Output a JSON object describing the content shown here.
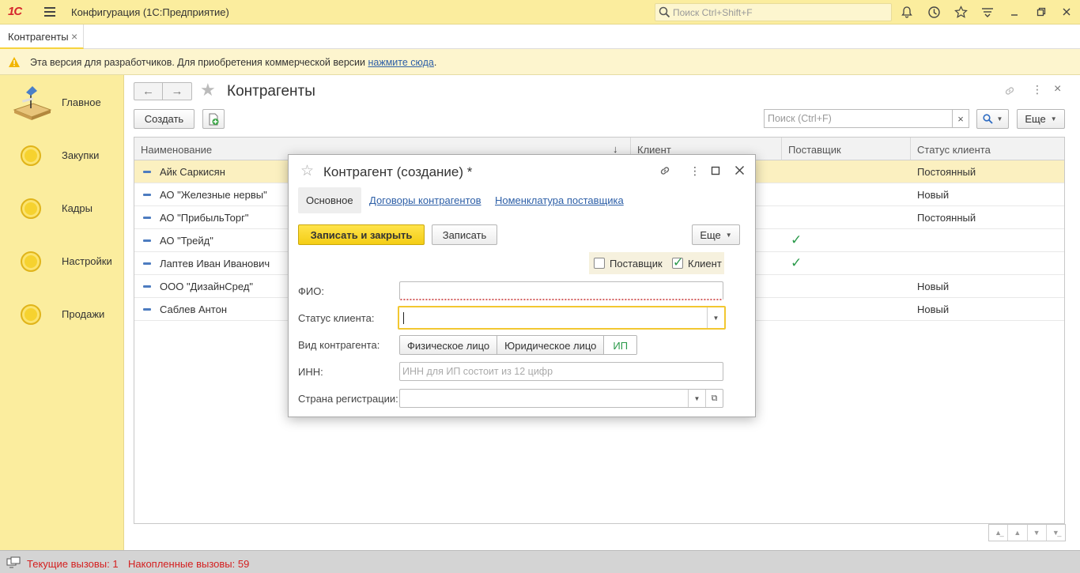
{
  "app": {
    "logo": "1С",
    "title": "Конфигурация  (1С:Предприятие)",
    "search_placeholder": "Поиск Ctrl+Shift+F"
  },
  "tabs": [
    {
      "label": "Контрагенты",
      "close": "×"
    }
  ],
  "infobar": {
    "text": "Эта версия для разработчиков. Для приобретения коммерческой версии ",
    "link": "нажмите сюда",
    "suffix": "."
  },
  "sidebar": {
    "items": [
      {
        "label": "Главное",
        "icon": "desk-lamp-icon"
      },
      {
        "label": "Закупки",
        "icon": "circle-icon"
      },
      {
        "label": "Кадры",
        "icon": "circle-icon"
      },
      {
        "label": "Настройки",
        "icon": "circle-icon"
      },
      {
        "label": "Продажи",
        "icon": "circle-icon"
      }
    ]
  },
  "list": {
    "title": "Контрагенты",
    "create_label": "Создать",
    "search_placeholder": "Поиск (Ctrl+F)",
    "clear": "×",
    "more_label": "Еще",
    "columns": [
      "Наименование",
      "Клиент",
      "Поставщик",
      "Статус клиента"
    ],
    "sort_indicator": "↓",
    "rows": [
      {
        "name": "Айк Саркисян",
        "client": false,
        "supplier": false,
        "status": "Постоянный",
        "selected": true
      },
      {
        "name": "АО \"Железные нервы\"",
        "client": false,
        "supplier": false,
        "status": "Новый",
        "selected": false
      },
      {
        "name": "АО \"ПрибыльТорг\"",
        "client": false,
        "supplier": false,
        "status": "Постоянный",
        "selected": false
      },
      {
        "name": "АО \"Трейд\"",
        "client": false,
        "supplier": true,
        "status": "",
        "selected": false
      },
      {
        "name": "Лаптев Иван Иванович",
        "client": false,
        "supplier": true,
        "status": "",
        "selected": false
      },
      {
        "name": "ООО \"ДизайнСред\"",
        "client": false,
        "supplier": false,
        "status": "Новый",
        "selected": false
      },
      {
        "name": "Саблев Антон",
        "client": false,
        "supplier": false,
        "status": "Новый",
        "selected": false
      }
    ]
  },
  "dialog": {
    "title": "Контрагент (создание) *",
    "tabs": [
      "Основное",
      "Договоры контрагентов",
      "Номенклатура поставщика"
    ],
    "save_close_label": "Записать и закрыть",
    "save_label": "Записать",
    "more_label": "Еще",
    "supplier_label": "Поставщик",
    "supplier_checked": false,
    "client_label": "Клиент",
    "client_checked": true,
    "fields": {
      "fio_label": "ФИО:",
      "fio_value": "",
      "status_label": "Статус клиента:",
      "status_value": "",
      "kind_label": "Вид контрагента:",
      "kind_options": [
        "Физическое лицо",
        "Юридическое лицо",
        "ИП"
      ],
      "kind_selected": "ИП",
      "inn_label": "ИНН:",
      "inn_placeholder": "ИНН для ИП состоит из 12 цифр",
      "country_label": "Страна регистрации:",
      "country_value": ""
    }
  },
  "statusbar": {
    "current_calls": "Текущие вызовы: 1",
    "accumulated_calls": "Накопленные вызовы: 59"
  },
  "colors": {
    "accent_yellow": "#fbed9e",
    "primary_button": "#f4cd15",
    "link": "#2d5fa7",
    "check": "#2a9a4a",
    "status_red": "#d42020"
  }
}
